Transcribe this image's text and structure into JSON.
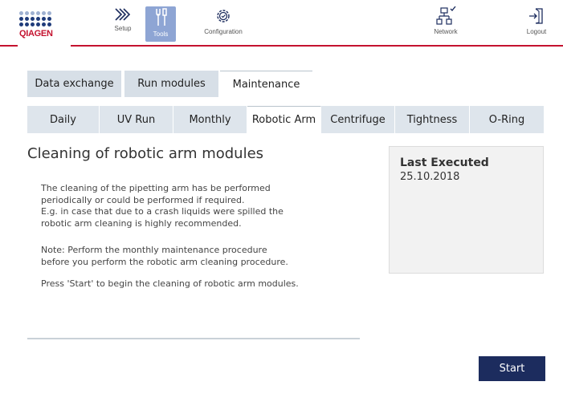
{
  "brand": {
    "logo_text": "QIAGEN"
  },
  "nav": {
    "setup": "Setup",
    "tools": "Tools",
    "configuration": "Configuration",
    "network": "Network",
    "logout": "Logout"
  },
  "tabs": {
    "data_exchange": "Data exchange",
    "run_modules": "Run modules",
    "maintenance": "Maintenance"
  },
  "subtabs": {
    "daily": "Daily",
    "uv_run": "UV Run",
    "monthly": "Monthly",
    "robotic_arm": "Robotic Arm",
    "centrifuge": "Centrifuge",
    "tightness": "Tightness",
    "o_ring": "O-Ring"
  },
  "content": {
    "title": "Cleaning of robotic arm modules",
    "para1": [
      "The cleaning of the pipetting arm has be performed",
      "periodically or could be performed if required.",
      "E.g. in case that due to a crash liquids were spilled the",
      "robotic arm cleaning is highly recommended."
    ],
    "para2": [
      "Note: Perform the monthly maintenance procedure",
      "before you perform the robotic arm cleaning procedure."
    ],
    "para3": "Press 'Start' to begin the cleaning of robotic arm modules."
  },
  "panel": {
    "label": "Last Executed",
    "value": "25.10.2018"
  },
  "actions": {
    "start": "Start"
  },
  "colors": {
    "brand_red": "#c4122f",
    "navy": "#1c2c5e",
    "active_nav": "#8ea5d4",
    "tab_inactive": "#d7dfe7"
  },
  "icons": {
    "setup": "chevrons-right-icon",
    "tools": "tools-icon",
    "configuration": "gear-icon",
    "network": "network-icon",
    "logout": "logout-icon"
  }
}
